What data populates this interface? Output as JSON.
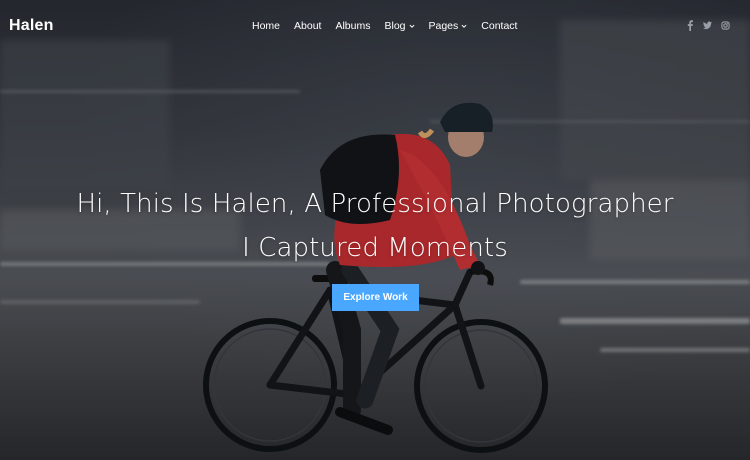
{
  "brand": {
    "logo_text": "Halen"
  },
  "nav": {
    "items": [
      {
        "label": "Home",
        "has_dropdown": false
      },
      {
        "label": "About",
        "has_dropdown": false
      },
      {
        "label": "Albums",
        "has_dropdown": false
      },
      {
        "label": "Blog",
        "has_dropdown": true
      },
      {
        "label": "Pages",
        "has_dropdown": true
      },
      {
        "label": "Contact",
        "has_dropdown": false
      }
    ]
  },
  "social": {
    "icons": [
      "facebook-icon",
      "twitter-icon",
      "instagram-icon"
    ]
  },
  "hero": {
    "headline_line1": "Hi, This Is Halen, A Professional Photographer",
    "headline_line2": "I Captured Moments",
    "cta_label": "Explore Work",
    "image_subject": "cyclist-motion-blur"
  },
  "colors": {
    "accent": "#4aa7ff",
    "text": "#ffffff",
    "jacket": "#d8373b"
  }
}
